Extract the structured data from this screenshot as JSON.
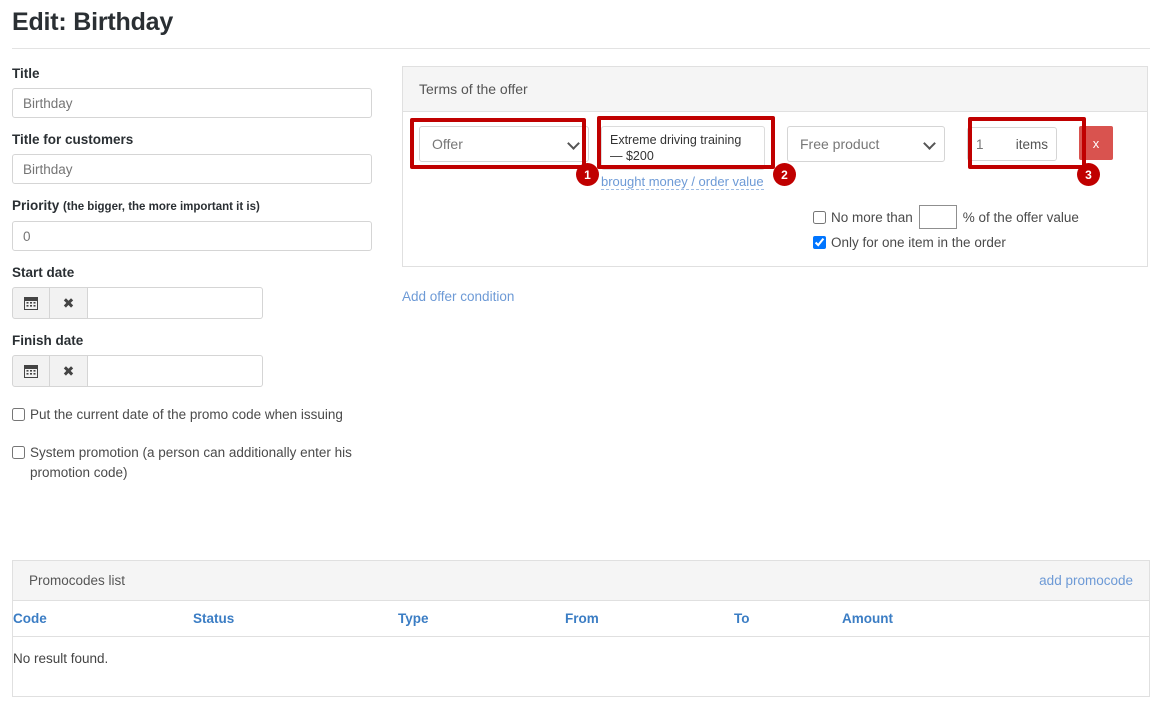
{
  "page": {
    "title": "Edit: Birthday"
  },
  "form": {
    "title_label": "Title",
    "title_value": "Birthday",
    "title_customers_label": "Title for customers",
    "title_customers_value": "Birthday",
    "priority_label": "Priority",
    "priority_hint": "(the bigger, the more important it is)",
    "priority_value": "0",
    "start_date_label": "Start date",
    "start_date_value": "",
    "finish_date_label": "Finish date",
    "finish_date_value": "",
    "calendar_icon": "calendar-icon",
    "clear_icon": "clear-icon",
    "checkbox_put_date_label": "Put the current date of the promo code when issuing",
    "checkbox_put_date_checked": false,
    "checkbox_system_promo_label": "System promotion (a person can additionally enter his promotion code)",
    "checkbox_system_promo_checked": false
  },
  "terms": {
    "panel_title": "Terms of the offer",
    "condition_type": "Offer",
    "condition_type_options": [
      "Offer"
    ],
    "product_value": "Extreme driving training — $200",
    "product_link": "brought money / order value",
    "reward_type": "Free product",
    "reward_type_options": [
      "Free product"
    ],
    "quantity_value": "1",
    "quantity_unit": "items",
    "delete_label": "x",
    "no_more_than_label": "No more than",
    "no_more_than_value": "",
    "no_more_than_suffix": "% of the offer value",
    "no_more_than_checked": false,
    "only_one_item_label": "Only for one item in the order",
    "only_one_item_checked": true,
    "add_condition_label": "Add offer condition"
  },
  "annotations": {
    "accent_color": "#c00000",
    "markers": [
      {
        "id": "1",
        "target": "condition-type-select"
      },
      {
        "id": "2",
        "target": "product-select"
      },
      {
        "id": "3",
        "target": "quantity-input"
      }
    ]
  },
  "promocodes": {
    "panel_title": "Promocodes list",
    "add_link": "add promocode",
    "columns": [
      "Code",
      "Status",
      "Type",
      "From",
      "To",
      "Amount"
    ],
    "empty_message": "No result found.",
    "rows": []
  }
}
